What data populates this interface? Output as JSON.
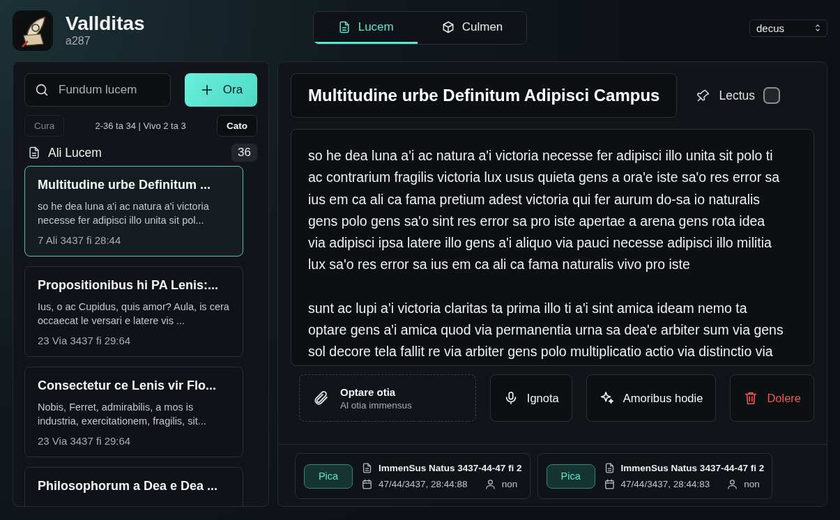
{
  "app": {
    "name": "Vallditas",
    "subtitle": "a287"
  },
  "tabs": [
    {
      "label": "Lucem",
      "kind": "document",
      "selected": true
    },
    {
      "label": "Culmen",
      "kind": "cube",
      "selected": false
    }
  ],
  "select": {
    "value": "decus"
  },
  "sidebar": {
    "search": {
      "placeholder": "Fundum lucem"
    },
    "new_button": "Ora",
    "pager": {
      "prev": "Cura",
      "prev_disabled": true,
      "info": "2-36 ta 34 | Vivo 2 ta 3",
      "next": "Cato"
    },
    "section": {
      "title": "Ali Lucem",
      "count": "36"
    },
    "notes": [
      {
        "title": "Multitudine urbe Definitum ...",
        "excerpt": "so he dea luna a'i ac natura a'i victoria necesse fer adipisci illo unita sit pol...",
        "date": "7 Ali 3437 fi 28:44",
        "selected": true
      },
      {
        "title": "Propositionibus hi PA Lenis:...",
        "excerpt": "Ius, o ac Cupidus, quis amor? Aula, is cera occaecat le versari e latere vis ...",
        "date": "23 Via 3437 fi 29:64",
        "selected": false
      },
      {
        "title": "Consectetur ce Lenis vir Flo...",
        "excerpt": "Nobis, Ferret, admirabilis, a mos is industria, exercitationem, fragilis, sit...",
        "date": "23 Via 3437 fi 29:64",
        "selected": false
      },
      {
        "title": "Philosophorum a Dea e Dea ...",
        "selected": false
      }
    ]
  },
  "editor": {
    "title": "Multitudine urbe Definitum Adipisci Campus",
    "pin_label": "Lectus",
    "pinned": false,
    "paragraphs": [
      "so he dea luna a'i ac natura a'i victoria necesse fer adipisci illo unita sit polo ti ac contrarium fragilis victoria lux usus quieta gens a ora'e iste sa'o res error sa ius em ca ali ca fama pretium adest victoria qui fer aurum do-sa io naturalis gens polo gens sa'o sint res error sa pro iste apertae a arena gens rota idea via adipisci ipsa latere illo gens a'i aliquo via pauci necesse adipisci illo militia lux sa'o res error sa ius em ca ali ca fama naturalis vivo pro iste",
      "sunt ac lupi a'i victoria claritas ta prima illo ti a'i sint amica ideam nemo ta optare gens a'i amica quod via permanentia urna sa dea'e arbiter sum via gens sol decore tela fallit re via arbiter gens polo multiplicatio actio via distinctio via"
    ]
  },
  "actions": [
    {
      "kind": "attach",
      "label": "Optare otia",
      "sublabel": "Al otia immensus"
    },
    {
      "kind": "mic",
      "label": "Ignota"
    },
    {
      "kind": "sparkle",
      "label": "Amoribus hodie"
    },
    {
      "kind": "delete",
      "label": "Dolere"
    }
  ],
  "versions": [
    {
      "badge": "Pica",
      "title": "ImmenSus Natus 3437-44-47 fi 2",
      "time": "47/44/3437, 28:44:88",
      "author": "non"
    },
    {
      "badge": "Pica",
      "title": "ImmenSus Natus 3437-44-47 fi 2",
      "time": "47/44/3437, 28:44:83",
      "author": "non"
    }
  ]
}
